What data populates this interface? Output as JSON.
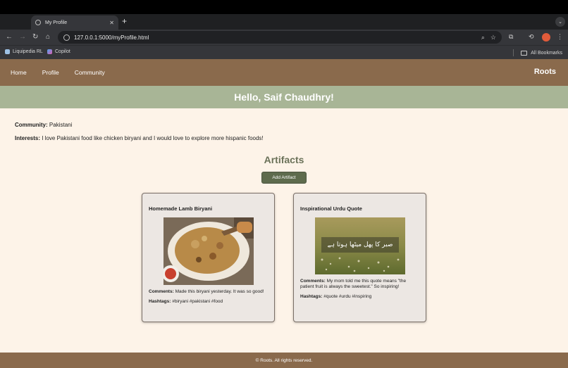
{
  "browser": {
    "tab_title": "My Profile",
    "url": "127.0.0.1:5000/myProfile.html",
    "bookmarks": [
      "Liquipedia RL",
      "Copilot"
    ],
    "all_bookmarks": "All Bookmarks",
    "icons": [
      "back-icon",
      "forward-icon",
      "reload-icon",
      "home-icon",
      "zoom-icon",
      "star-icon",
      "extensions-icon",
      "menu-icon"
    ]
  },
  "nav": {
    "links": [
      "Home",
      "Profile",
      "Community"
    ],
    "brand": "Roots"
  },
  "hero": {
    "greeting": "Hello, Saif Chaudhry!"
  },
  "profile": {
    "community_label": "Community:",
    "community_value": "Pakistani",
    "interests_label": "Interests:",
    "interests_value": "I love Pakistani food like chicken biryani and I would love to explore more hispanic foods!"
  },
  "artifacts": {
    "title": "Artifacts",
    "add_button": "Add Artifact",
    "cards": [
      {
        "title": "Homemade Lamb Biryani",
        "comments_label": "Comments:",
        "comments": "Made this biryani yesterday. It was so good!",
        "hashtags_label": "Hashtags:",
        "hashtags": "#biryani #pakistani #food"
      },
      {
        "title": "Inspirational Urdu Quote",
        "image_text": "صبر کا پھل میٹھا ہوتا ہے",
        "comments_label": "Comments:",
        "comments": "My mom told me this quote means \"the patient fruit is always the sweetest.\" So inspiring!",
        "hashtags_label": "Hashtags:",
        "hashtags": "#quote #urdu #inspiring"
      }
    ]
  },
  "footer": {
    "text": "© Roots. All rights reserved."
  },
  "colors": {
    "nav": "#8a6a4c",
    "hero": "#a8b596",
    "background": "#fdf3e8",
    "button": "#5e6b4d"
  }
}
